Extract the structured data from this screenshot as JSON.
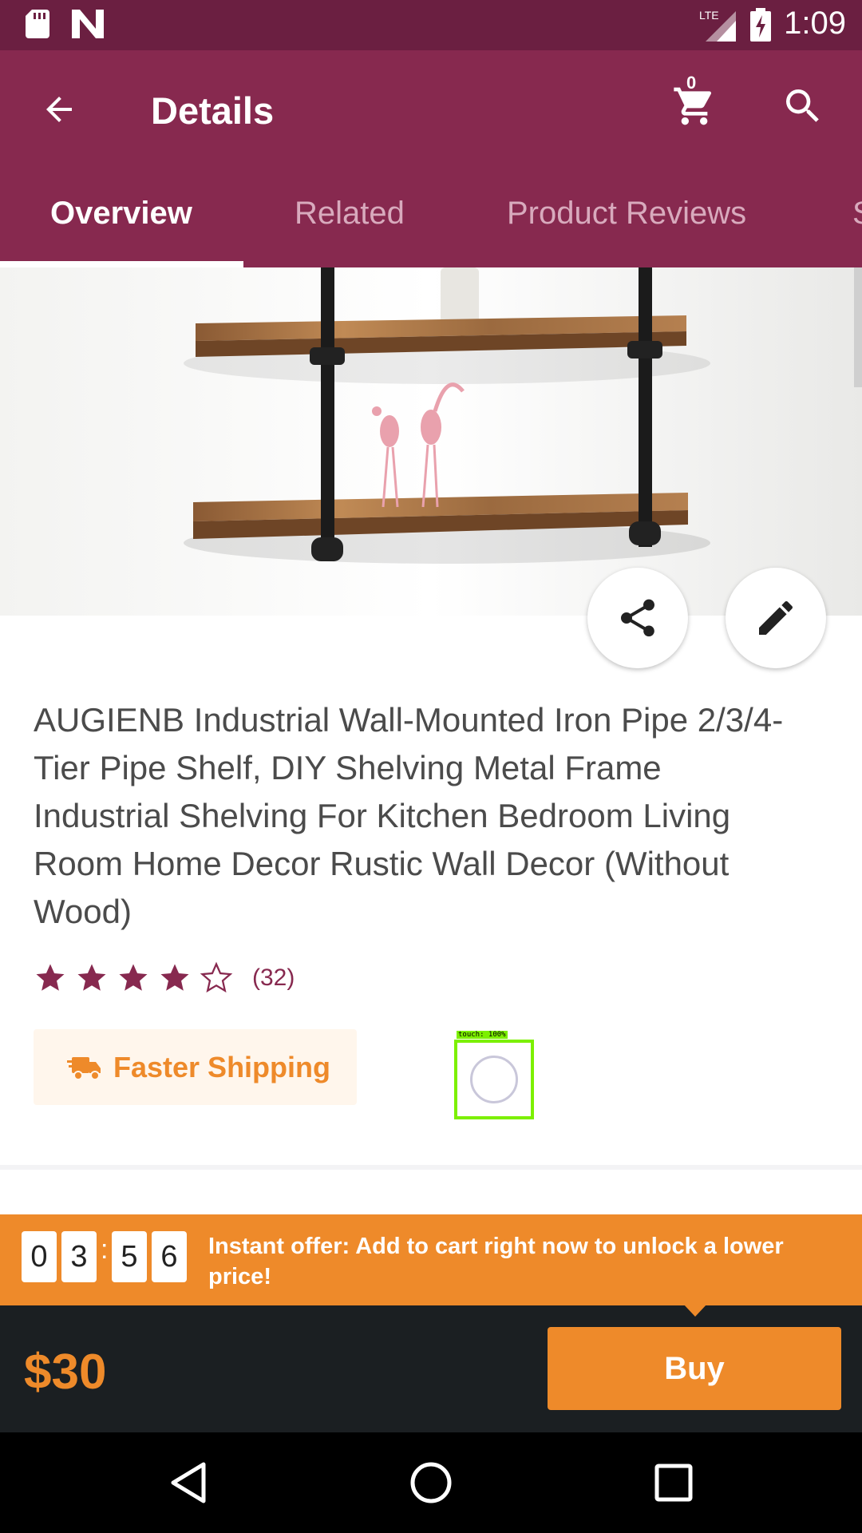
{
  "status_bar": {
    "time": "1:09",
    "network": "LTE"
  },
  "app_bar": {
    "title": "Details",
    "cart_count": "0",
    "icons": [
      "back-arrow-icon",
      "cart-icon",
      "search-icon"
    ]
  },
  "tabs": [
    {
      "label": "Overview",
      "active": true
    },
    {
      "label": "Related",
      "active": false
    },
    {
      "label": "Product Reviews",
      "active": false
    },
    {
      "label": "S",
      "active": false
    }
  ],
  "product": {
    "title": "AUGIENB Industrial Wall-Mounted Iron Pipe 2/3/4-Tier Pipe Shelf, DIY Shelving Metal Frame Industrial Shelving For Kitchen Bedroom Living Room Home Decor Rustic Wall Decor (Without Wood)",
    "rating": 4,
    "rating_max": 5,
    "review_count": "(32)",
    "shipping_badge": "Faster Shipping"
  },
  "touch_indicator": {
    "label": "touch: 100%"
  },
  "offer": {
    "timer_digits": [
      "0",
      "3",
      "5",
      "6"
    ],
    "timer_separator": ":",
    "text": "Instant offer: Add to cart right now to unlock a lower price!"
  },
  "buy_bar": {
    "price": "$30",
    "buy_label": "Buy"
  },
  "colors": {
    "primary": "#87294f",
    "status_bar": "#6b1f41",
    "accent": "#ee8a2a",
    "buy_bar_bg": "#1b1f22"
  }
}
